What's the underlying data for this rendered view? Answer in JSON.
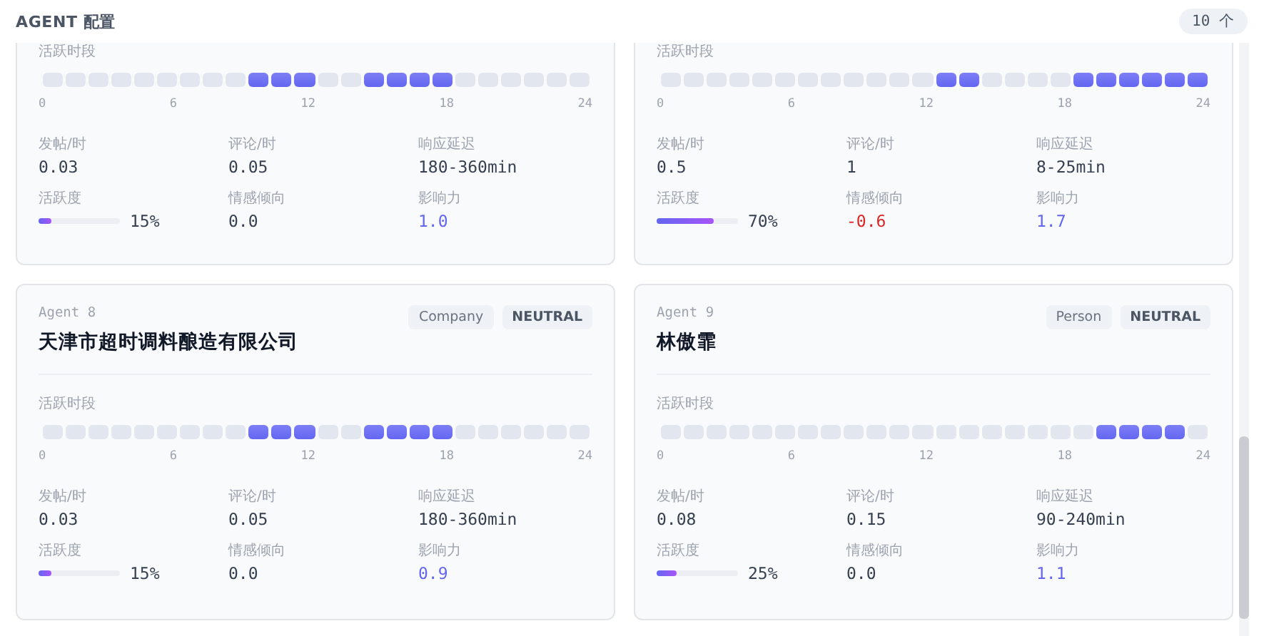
{
  "header": {
    "title": "AGENT 配置",
    "count": "10 个"
  },
  "cards": [
    {
      "hours_label": "活跃时段",
      "hours": [
        false,
        false,
        false,
        false,
        false,
        false,
        false,
        false,
        false,
        true,
        true,
        true,
        false,
        false,
        true,
        true,
        true,
        true,
        false,
        false,
        false,
        false,
        false,
        false
      ],
      "ticks": [
        "0",
        "6",
        "12",
        "18",
        "24"
      ],
      "metrics": [
        {
          "kind": "text",
          "label": "发帖/时",
          "value": "0.03"
        },
        {
          "kind": "text",
          "label": "评论/时",
          "value": "0.05"
        },
        {
          "kind": "text",
          "label": "响应延迟",
          "value": "180-360min"
        },
        {
          "kind": "bar",
          "label": "活跃度",
          "value": "15%",
          "level": 0.15
        },
        {
          "kind": "text",
          "label": "情感倾向",
          "value": "0.0"
        },
        {
          "kind": "influence",
          "label": "影响力",
          "value": "1.0"
        }
      ]
    },
    {
      "hours_label": "活跃时段",
      "hours": [
        false,
        false,
        false,
        false,
        false,
        false,
        false,
        false,
        false,
        false,
        false,
        false,
        true,
        true,
        false,
        false,
        false,
        false,
        true,
        true,
        true,
        true,
        true,
        true
      ],
      "ticks": [
        "0",
        "6",
        "12",
        "18",
        "24"
      ],
      "metrics": [
        {
          "kind": "text",
          "label": "发帖/时",
          "value": "0.5"
        },
        {
          "kind": "text",
          "label": "评论/时",
          "value": "1"
        },
        {
          "kind": "text",
          "label": "响应延迟",
          "value": "8-25min"
        },
        {
          "kind": "bar",
          "label": "活跃度",
          "value": "70%",
          "level": 0.7
        },
        {
          "kind": "negative",
          "label": "情感倾向",
          "value": "-0.6"
        },
        {
          "kind": "influence",
          "label": "影响力",
          "value": "1.7"
        }
      ]
    },
    {
      "agent": "Agent 8",
      "name": "天津市超时调料酿造有限公司",
      "tags": [
        "Company",
        "NEUTRAL"
      ],
      "hours_label": "活跃时段",
      "hours": [
        false,
        false,
        false,
        false,
        false,
        false,
        false,
        false,
        false,
        true,
        true,
        true,
        false,
        false,
        true,
        true,
        true,
        true,
        false,
        false,
        false,
        false,
        false,
        false
      ],
      "ticks": [
        "0",
        "6",
        "12",
        "18",
        "24"
      ],
      "metrics": [
        {
          "kind": "text",
          "label": "发帖/时",
          "value": "0.03"
        },
        {
          "kind": "text",
          "label": "评论/时",
          "value": "0.05"
        },
        {
          "kind": "text",
          "label": "响应延迟",
          "value": "180-360min"
        },
        {
          "kind": "bar",
          "label": "活跃度",
          "value": "15%",
          "level": 0.15
        },
        {
          "kind": "text",
          "label": "情感倾向",
          "value": "0.0"
        },
        {
          "kind": "influence",
          "label": "影响力",
          "value": "0.9"
        }
      ]
    },
    {
      "agent": "Agent 9",
      "name": "林傲霏",
      "tags": [
        "Person",
        "NEUTRAL"
      ],
      "hours_label": "活跃时段",
      "hours": [
        false,
        false,
        false,
        false,
        false,
        false,
        false,
        false,
        false,
        false,
        false,
        false,
        false,
        false,
        false,
        false,
        false,
        false,
        false,
        true,
        true,
        true,
        true,
        false
      ],
      "ticks": [
        "0",
        "6",
        "12",
        "18",
        "24"
      ],
      "metrics": [
        {
          "kind": "text",
          "label": "发帖/时",
          "value": "0.08"
        },
        {
          "kind": "text",
          "label": "评论/时",
          "value": "0.15"
        },
        {
          "kind": "text",
          "label": "响应延迟",
          "value": "90-240min"
        },
        {
          "kind": "bar",
          "label": "活跃度",
          "value": "25%",
          "level": 0.25
        },
        {
          "kind": "text",
          "label": "情感倾向",
          "value": "0.0"
        },
        {
          "kind": "influence",
          "label": "影响力",
          "value": "1.1"
        }
      ]
    }
  ]
}
